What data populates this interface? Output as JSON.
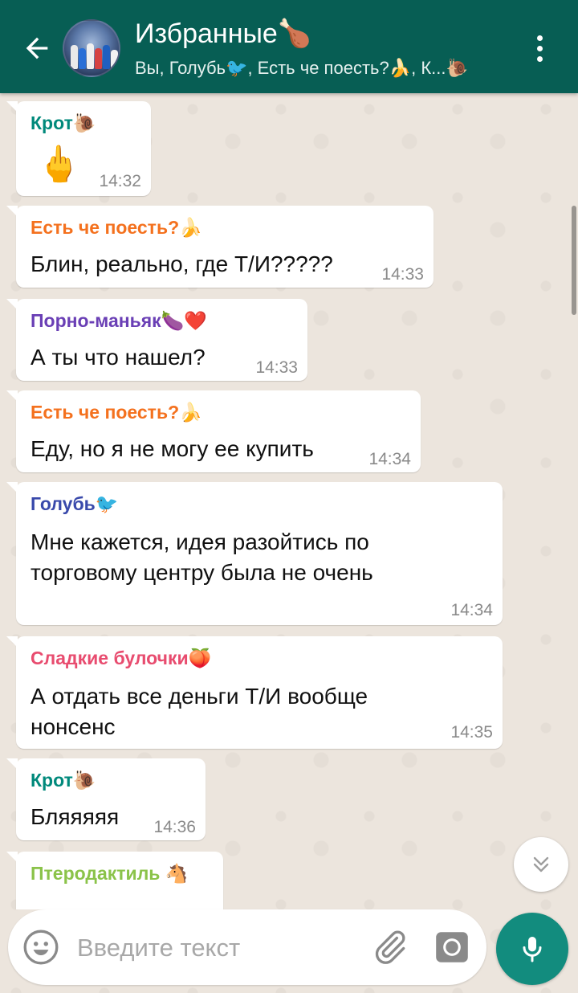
{
  "header": {
    "title": "Избранные🍗",
    "subtitle": "Вы, Голубь🐦, Есть че поесть?🍌, К...🐌",
    "colors": {
      "bar": "#075e54",
      "accent": "#128c7e"
    }
  },
  "messages": [
    {
      "sender": "Крот🐌",
      "sender_color": "#00897b",
      "emoji": "🖕",
      "time": "14:32"
    },
    {
      "sender": "Есть че поесть?🍌",
      "sender_color": "#f4711e",
      "lines": [
        "Блин, реально, где Т/И?????"
      ],
      "time": "14:33"
    },
    {
      "sender": "Порно-маньяк🍆❤️",
      "sender_color": "#6a3fb5",
      "lines": [
        "А ты что нашел?"
      ],
      "time": "14:33"
    },
    {
      "sender": "Есть че поесть?🍌",
      "sender_color": "#f4711e",
      "lines": [
        "Еду, но я не могу ее купить"
      ],
      "time": "14:34"
    },
    {
      "sender": "Голубь🐦",
      "sender_color": "#3949ab",
      "lines": [
        "Мне кажется, идея разойтись по",
        "торговому центру была не очень"
      ],
      "time": "14:34"
    },
    {
      "sender": "Сладкие булочки🍑",
      "sender_color": "#e84c6f",
      "lines": [
        "А отдать все деньги Т/И вообще",
        "нонсенс"
      ],
      "time": "14:35"
    },
    {
      "sender": "Крот🐌",
      "sender_color": "#00897b",
      "lines": [
        "Бляяяяя"
      ],
      "time": "14:36"
    },
    {
      "sender": "Птеродактиль 🐴",
      "sender_color": "#8bc34a"
    }
  ],
  "input": {
    "placeholder": "Введите текст"
  },
  "icons": {
    "back": "arrow-left-icon",
    "menu": "more-vert-icon",
    "emoji": "smiley-icon",
    "attach": "paperclip-icon",
    "camera": "camera-icon",
    "mic": "microphone-icon",
    "scroll": "chevron-double-down-icon"
  }
}
